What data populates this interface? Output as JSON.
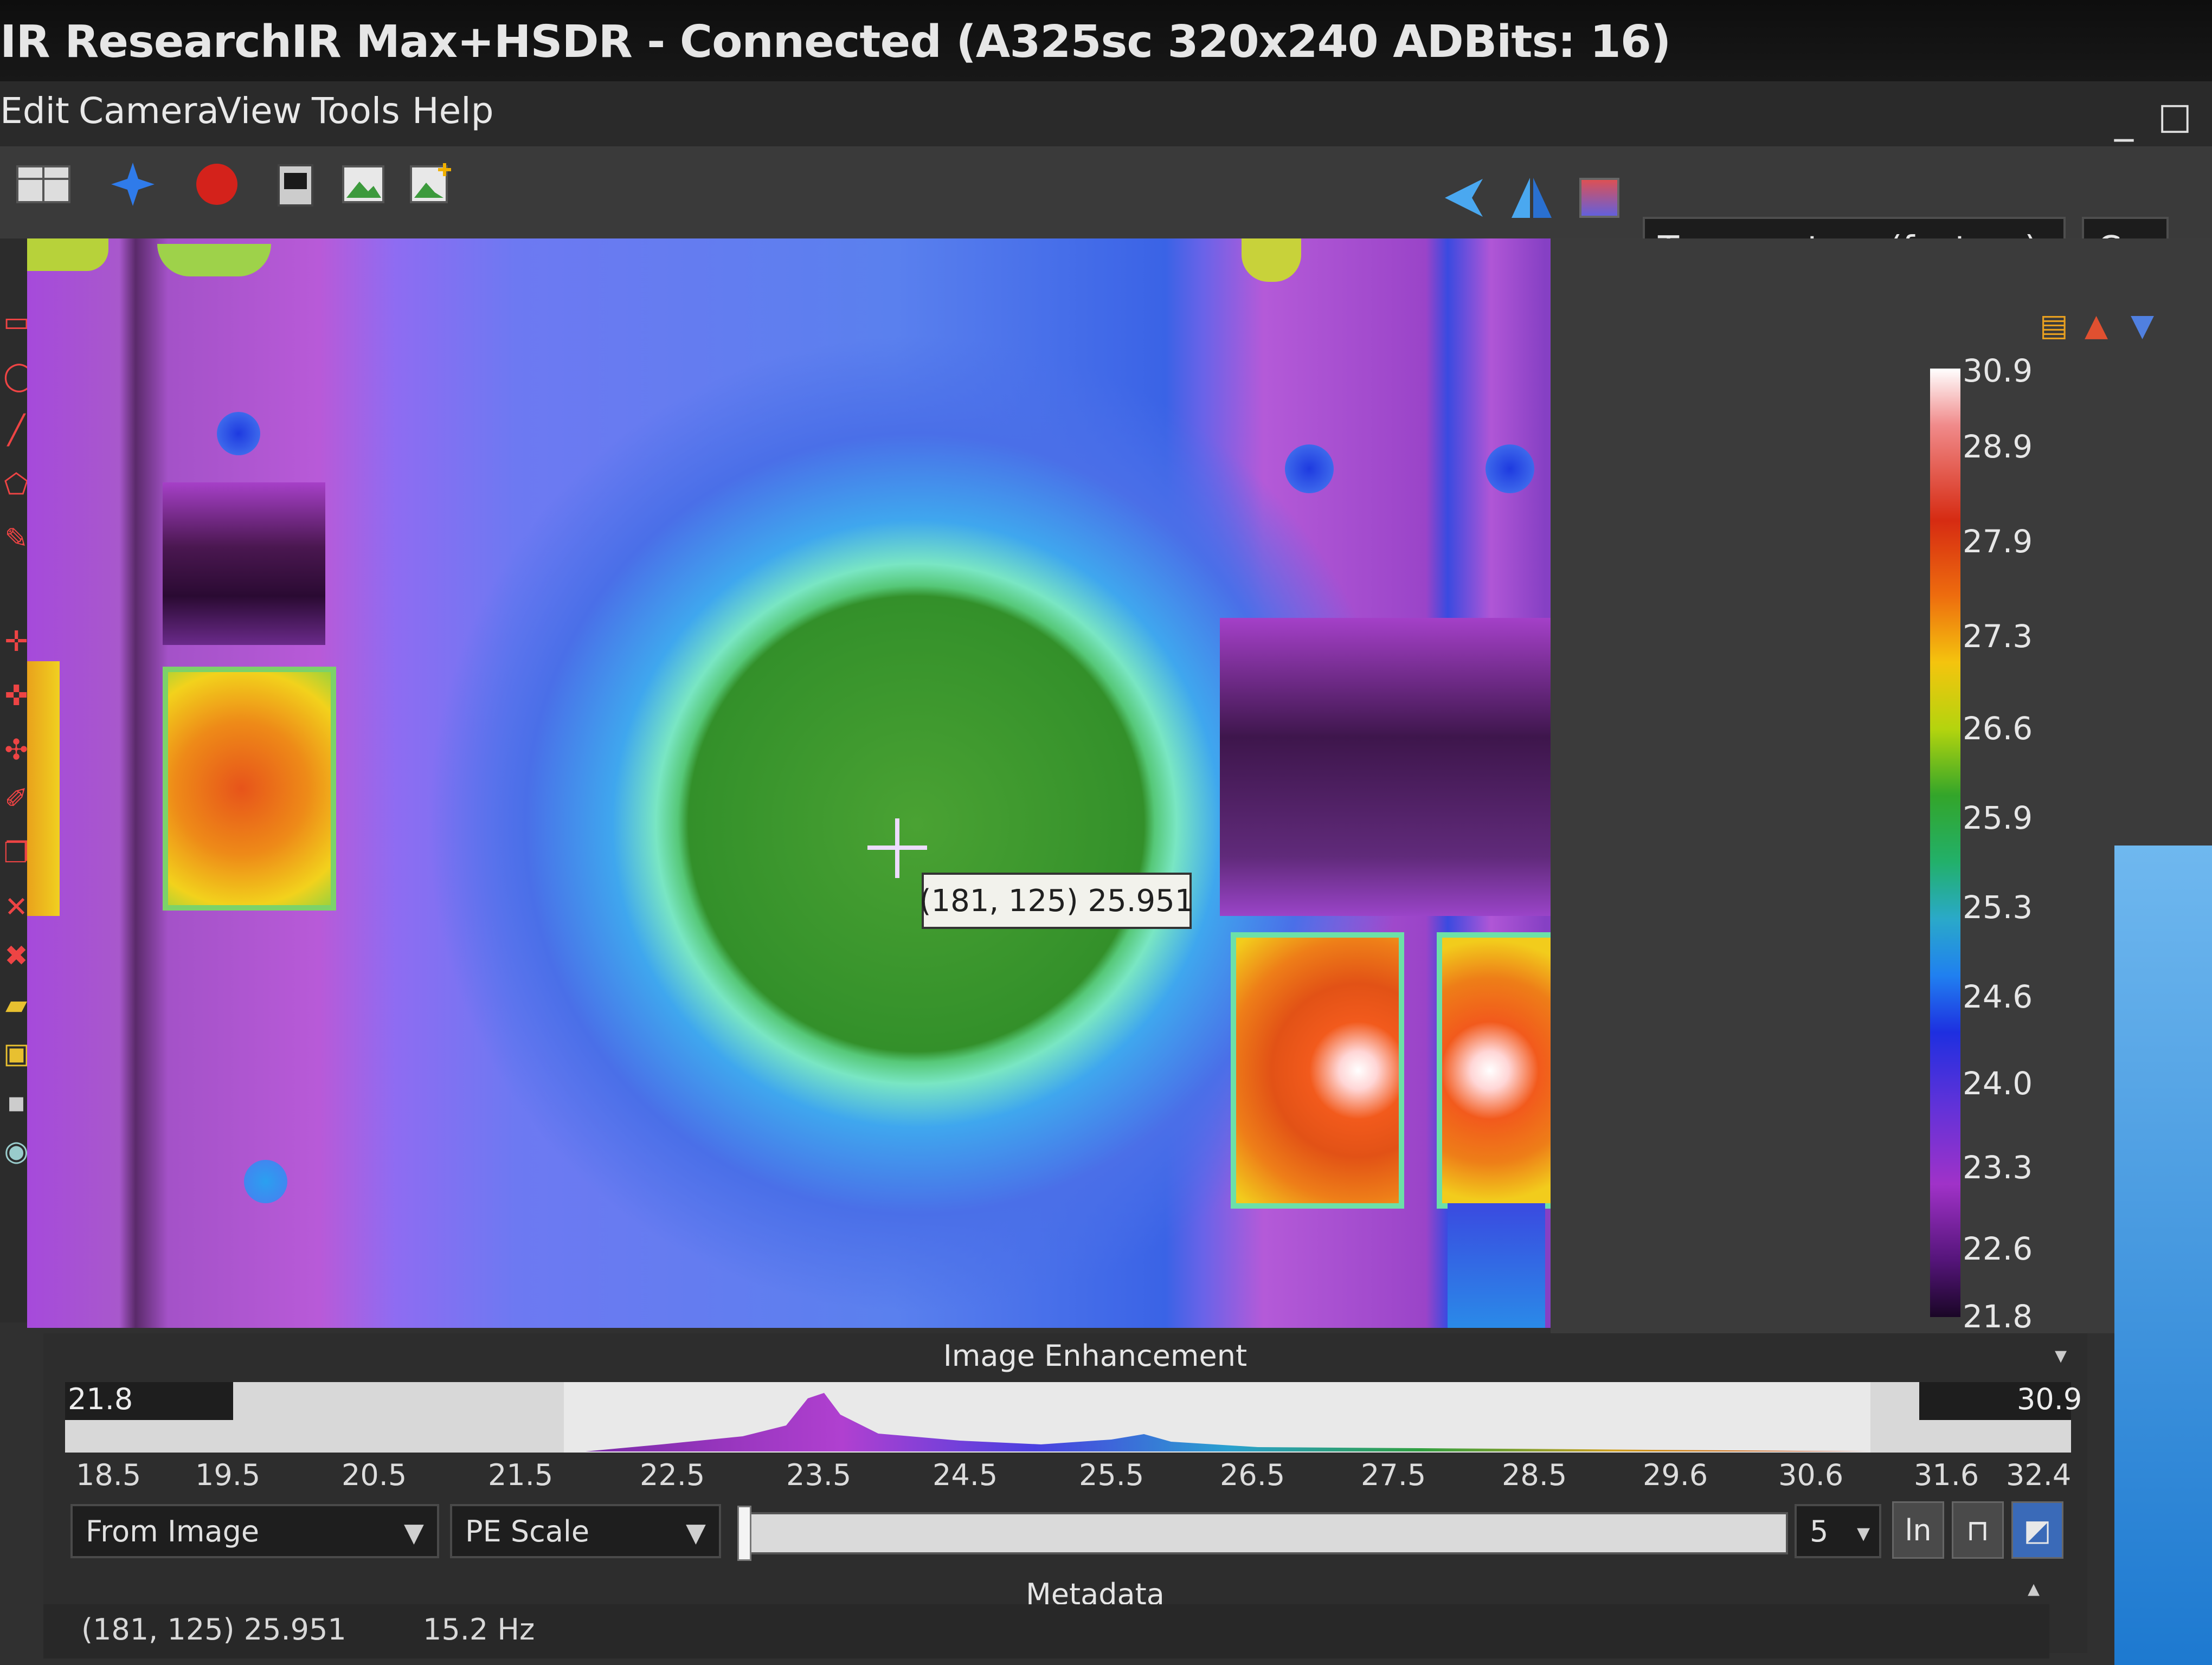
{
  "window": {
    "title": "IR ResearchIR Max+HSDR - Connected (A325sc 320x240 ADBits: 16)"
  },
  "menu": [
    "Edit",
    "Camera",
    "View",
    "Tools",
    "Help"
  ],
  "window_controls": {
    "minimize": "_",
    "maximize": "☐"
  },
  "toolbar": {
    "units_mode": "Temperature (factory)",
    "unit": "C"
  },
  "image": {
    "probe_readout": "(181, 125) 25.951"
  },
  "color_scale": {
    "labels": [
      "30.9",
      "28.9",
      "27.9",
      "27.3",
      "26.6",
      "25.9",
      "25.3",
      "24.6",
      "24.0",
      "23.3",
      "22.6",
      "21.8"
    ]
  },
  "enhancement": {
    "title": "Image Enhancement",
    "min_value": "21.8",
    "max_value": "30.9",
    "axis_ticks": [
      "18.5",
      "19.5",
      "20.5",
      "21.5",
      "22.5",
      "23.5",
      "24.5",
      "25.5",
      "26.5",
      "27.5",
      "28.5",
      "29.6",
      "30.6",
      "31.6",
      "32.4"
    ],
    "source_select": "From Image",
    "scale_select": "PE Scale",
    "step_select": "5",
    "ln_button": "ln"
  },
  "metadata": {
    "title": "Metadata",
    "position_value": "(181, 125) 25.951",
    "rate": "15.2 Hz"
  },
  "colors": {
    "accent_blue": "#2f7bea",
    "record_red": "#d4221b"
  }
}
